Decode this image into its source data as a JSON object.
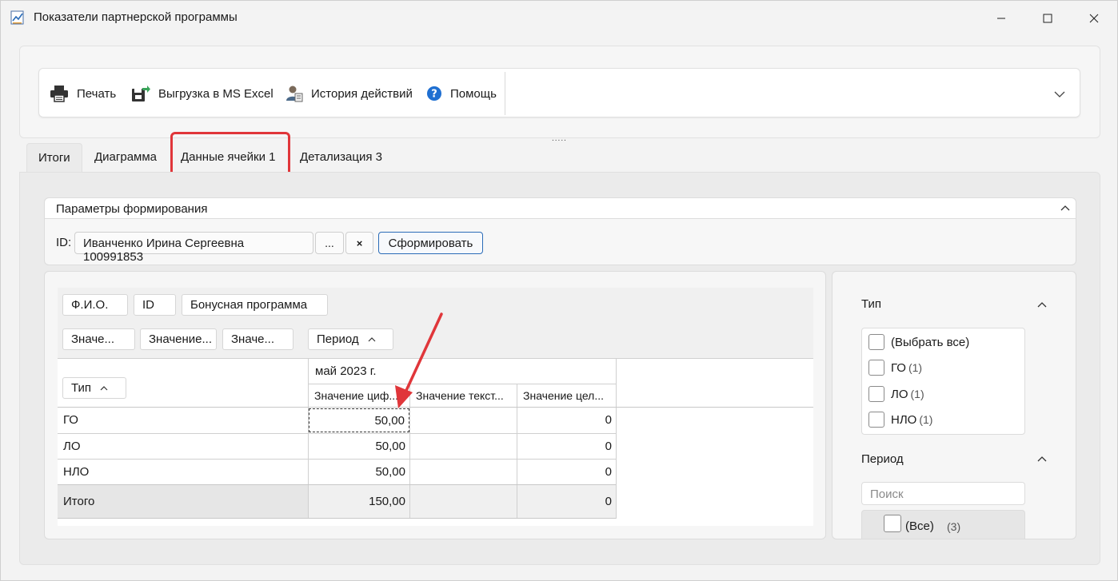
{
  "window": {
    "title": "Показатели партнерской программы",
    "icon": "chart-icon"
  },
  "toolbar": {
    "print": "Печать",
    "excel": "Выгрузка в MS Excel",
    "history": "История действий",
    "help": "Помощь"
  },
  "tabs": [
    {
      "label": "Итоги",
      "active": true
    },
    {
      "label": "Диаграмма",
      "active": false
    },
    {
      "label": "Данные ячейки 1",
      "active": false,
      "highlighted": true
    },
    {
      "label": "Детализация 3",
      "active": false
    }
  ],
  "params": {
    "title": "Параметры формирования",
    "id_label": "ID:",
    "id_value": "Иванченко Ирина Сергеевна 100991853",
    "browse": "...",
    "clear": "×",
    "form_button": "Сформировать"
  },
  "pivot": {
    "filter_fields": [
      "Ф.И.О.",
      "ID",
      "Бонусная программа"
    ],
    "data_fields": [
      "Значе...",
      "Значение...",
      "Значе..."
    ],
    "column_field": "Период",
    "row_field": "Тип",
    "period_header": "май 2023 г.",
    "value_headers": [
      "Значение циф...",
      "Значение текст...",
      "Значение цел..."
    ],
    "rows": [
      {
        "label": "ГО",
        "num": "50,00",
        "text": "",
        "int": "0"
      },
      {
        "label": "ЛО",
        "num": "50,00",
        "text": "",
        "int": "0"
      },
      {
        "label": "НЛО",
        "num": "50,00",
        "text": "",
        "int": "0"
      }
    ],
    "total": {
      "label": "Итого",
      "num": "150,00",
      "text": "",
      "int": "0"
    }
  },
  "filters": {
    "type_title": "Тип",
    "type_items": [
      {
        "label": "(Выбрать все)",
        "count": ""
      },
      {
        "label": "ГО",
        "count": "(1)"
      },
      {
        "label": "ЛО",
        "count": "(1)"
      },
      {
        "label": "НЛО",
        "count": "(1)"
      }
    ],
    "period_title": "Период",
    "search_placeholder": "Поиск",
    "all_label": "(Все)",
    "all_count": "(3)"
  },
  "colors": {
    "highlight": "#e0363a",
    "accent_blue": "#2b6cb8"
  }
}
